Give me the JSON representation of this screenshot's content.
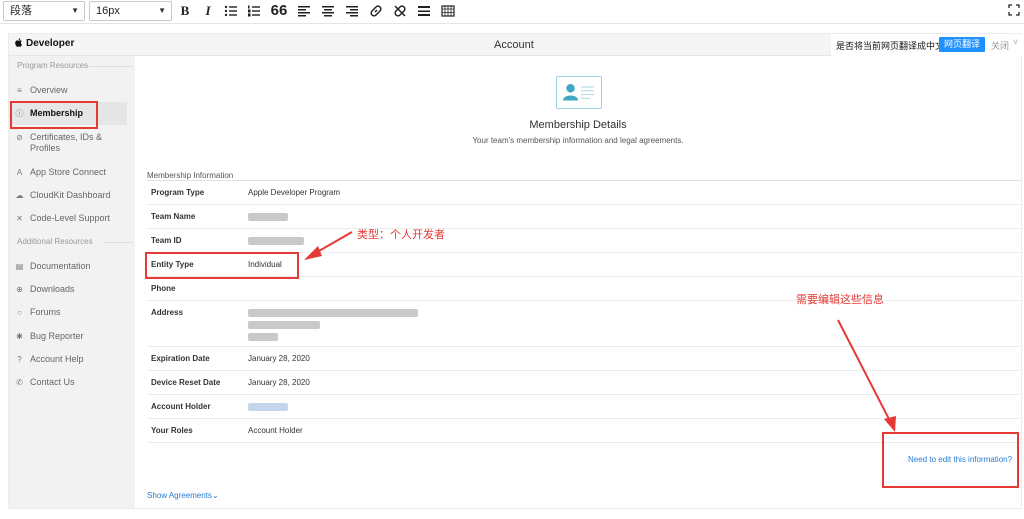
{
  "toolbar": {
    "paragraph_select": "段落",
    "font_size_select": "16px",
    "bold_label": "B",
    "italic_label": "I",
    "quote_label": "66"
  },
  "topbar": {
    "brand": "Developer",
    "page_title": "Account"
  },
  "translate_bar": {
    "prompt": "是否将当前网页翻译成中文",
    "translate_button": "网页翻译",
    "close": "关闭"
  },
  "sidebar": {
    "heading_program": "Program Resources",
    "program_items": [
      {
        "label": "Overview",
        "icon": "list-icon"
      },
      {
        "label": "Membership",
        "icon": "info-circle-icon"
      },
      {
        "label": "Certificates, IDs &",
        "label2": "Profiles",
        "icon": "check-circle-icon"
      },
      {
        "label": "App Store Connect",
        "icon": "app-store-icon"
      },
      {
        "label": "CloudKit Dashboard",
        "icon": "cloud-icon"
      },
      {
        "label": "Code-Level Support",
        "icon": "tools-icon"
      }
    ],
    "heading_additional": "Additional Resources",
    "additional_items": [
      {
        "label": "Documentation",
        "icon": "document-icon"
      },
      {
        "label": "Downloads",
        "icon": "download-icon"
      },
      {
        "label": "Forums",
        "icon": "chat-icon"
      },
      {
        "label": "Bug Reporter",
        "icon": "bug-icon"
      },
      {
        "label": "Account Help",
        "icon": "help-icon"
      },
      {
        "label": "Contact Us",
        "icon": "phone-icon"
      }
    ]
  },
  "main": {
    "title": "Membership Details",
    "subtitle": "Your team's membership information and legal agreements.",
    "section_label": "Membership Information",
    "rows": [
      {
        "key": "Program Type",
        "value": "Apple Developer Program"
      },
      {
        "key": "Team Name",
        "value": ""
      },
      {
        "key": "Team ID",
        "value": ""
      },
      {
        "key": "Entity Type",
        "value": "Individual"
      },
      {
        "key": "Phone",
        "value": ""
      },
      {
        "key": "Address",
        "value": ""
      },
      {
        "key": "Expiration Date",
        "value": "January 28, 2020"
      },
      {
        "key": "Device Reset Date",
        "value": "January 28, 2020"
      },
      {
        "key": "Account Holder",
        "value": ""
      },
      {
        "key": "Your Roles",
        "value": "Account Holder"
      }
    ],
    "edit_link": "Need to edit this information?",
    "show_agreements": "Show Agreements"
  },
  "annotations": {
    "entity_note": "类型：个人开发者",
    "edit_note": "需要编辑这些信息"
  },
  "colors": {
    "annotation": "#e53935",
    "link": "#2a7ad2",
    "translate_button": "#1e90ff"
  }
}
